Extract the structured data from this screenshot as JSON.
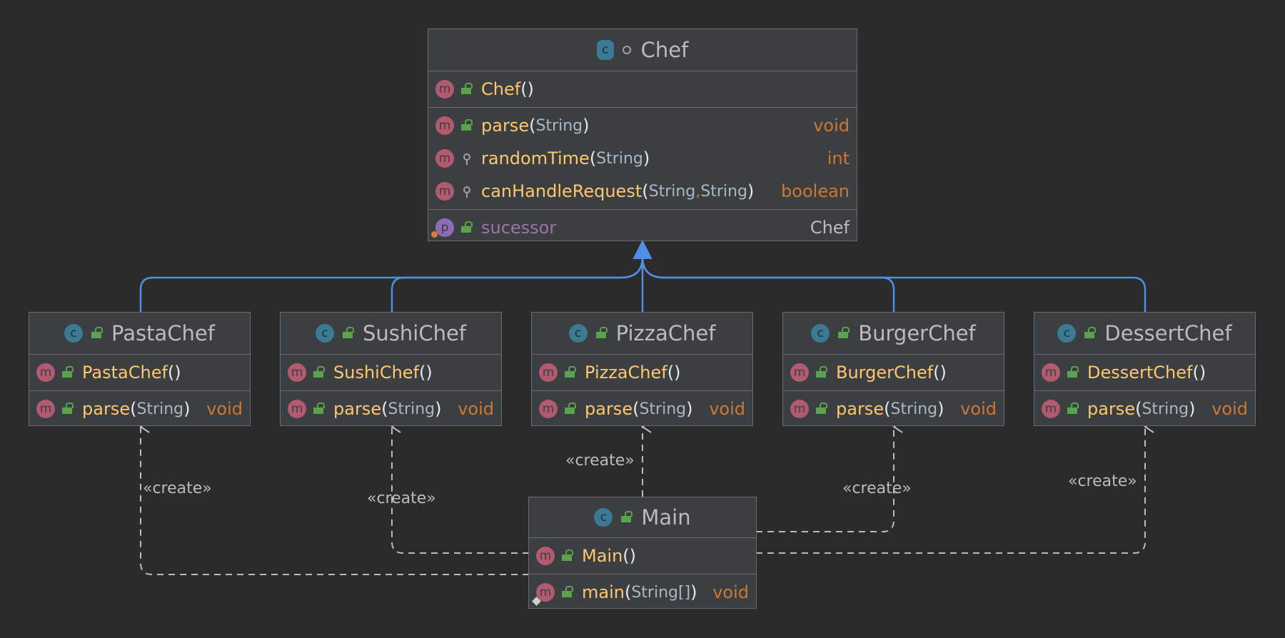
{
  "colors": {
    "background": "#2b2b2b",
    "class_fill": "#3c3f41",
    "inheritance_edge": "#4f8fe6",
    "dependency_edge": "#bbbbbb",
    "method_name": "#ffc66d",
    "return_type": "#cc7832",
    "field_name": "#9876aa"
  },
  "classes": {
    "chef": {
      "name": "Chef",
      "icon": "abstract-class-icon",
      "constructor": "Chef",
      "methods": [
        {
          "name": "parse",
          "params": [
            "String"
          ],
          "return": "void",
          "visibility": "public"
        },
        {
          "name": "randomTime",
          "params": [
            "String"
          ],
          "return": "int",
          "visibility": "package"
        },
        {
          "name": "canHandleRequest",
          "params": [
            "String",
            "String"
          ],
          "return": "boolean",
          "visibility": "package"
        }
      ],
      "field": {
        "name": "sucessor",
        "type": "Chef"
      }
    },
    "pastachef": {
      "name": "PastaChef",
      "constructor": "PastaChef",
      "method": "parse",
      "param": "String",
      "return": "void"
    },
    "sushichef": {
      "name": "SushiChef",
      "constructor": "SushiChef",
      "method": "parse",
      "param": "String",
      "return": "void"
    },
    "pizzachef": {
      "name": "PizzaChef",
      "constructor": "PizzaChef",
      "method": "parse",
      "param": "String",
      "return": "void"
    },
    "burgerchef": {
      "name": "BurgerChef",
      "constructor": "BurgerChef",
      "method": "parse",
      "param": "String",
      "return": "void"
    },
    "dessertchef": {
      "name": "DessertChef",
      "constructor": "DessertChef",
      "method": "parse",
      "param": "String",
      "return": "void"
    },
    "main": {
      "name": "Main",
      "constructor": "Main",
      "method": "main",
      "param": "String[]",
      "return": "void"
    }
  },
  "edges": {
    "inheritance": [
      {
        "from": "PastaChef",
        "to": "Chef"
      },
      {
        "from": "SushiChef",
        "to": "Chef"
      },
      {
        "from": "PizzaChef",
        "to": "Chef"
      },
      {
        "from": "BurgerChef",
        "to": "Chef"
      },
      {
        "from": "DessertChef",
        "to": "Chef"
      }
    ],
    "create": [
      {
        "from": "Main",
        "to": "PastaChef",
        "label": "«create»"
      },
      {
        "from": "Main",
        "to": "SushiChef",
        "label": "«create»"
      },
      {
        "from": "Main",
        "to": "PizzaChef",
        "label": "«create»"
      },
      {
        "from": "Main",
        "to": "BurgerChef",
        "label": "«create»"
      },
      {
        "from": "Main",
        "to": "DessertChef",
        "label": "«create»"
      }
    ]
  }
}
